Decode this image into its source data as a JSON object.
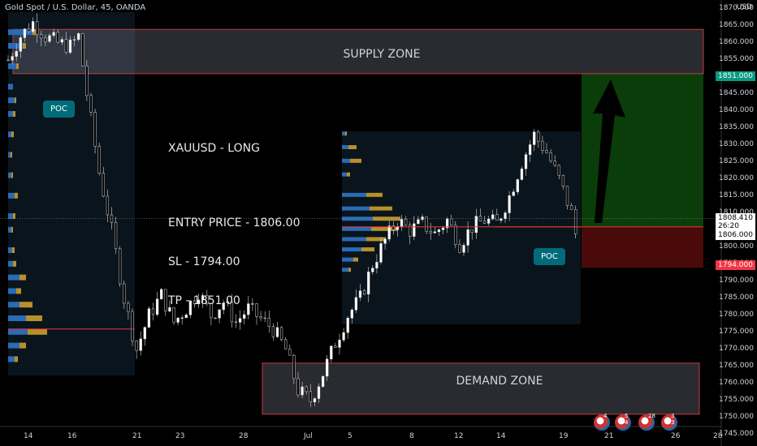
{
  "header": {
    "symbol_line": "Gold Spot / U.S. Dollar, 45, OANDA",
    "currency": "USD"
  },
  "chart_data": {
    "type": "candlestick",
    "y_axis": {
      "ylim": [
        1745,
        1870
      ],
      "tick_labels": [
        "1870.000",
        "1865.000",
        "1860.000",
        "1855.000",
        "1850.000",
        "1845.000",
        "1840.000",
        "1835.000",
        "1830.000",
        "1825.000",
        "1820.000",
        "1815.000",
        "1810.000",
        "1805.000",
        "1800.000",
        "1795.000",
        "1790.000",
        "1785.000",
        "1780.000",
        "1775.000",
        "1770.000",
        "1765.000",
        "1760.000",
        "1755.000",
        "1750.000",
        "1745.000"
      ]
    },
    "x_axis": {
      "tick_labels": [
        "14",
        "16",
        "21",
        "23",
        "28",
        "Jul",
        "5",
        "8",
        "12",
        "14",
        "19",
        "21",
        "26",
        "28"
      ]
    },
    "price_path": [
      [
        0,
        1855
      ],
      [
        3,
        1862
      ],
      [
        6,
        1866
      ],
      [
        9,
        1862
      ],
      [
        12,
        1860
      ],
      [
        15,
        1859
      ],
      [
        17,
        1862
      ],
      [
        19,
        1845
      ],
      [
        22,
        1822
      ],
      [
        25,
        1805
      ],
      [
        28,
        1785
      ],
      [
        31,
        1770
      ],
      [
        34,
        1780
      ],
      [
        37,
        1786
      ],
      [
        40,
        1778
      ],
      [
        43,
        1782
      ],
      [
        46,
        1787
      ],
      [
        49,
        1780
      ],
      [
        52,
        1784
      ],
      [
        55,
        1778
      ],
      [
        58,
        1782
      ],
      [
        61,
        1779
      ],
      [
        64,
        1776
      ],
      [
        67,
        1770
      ],
      [
        70,
        1758
      ],
      [
        73,
        1755
      ],
      [
        76,
        1763
      ],
      [
        79,
        1772
      ],
      [
        82,
        1780
      ],
      [
        85,
        1785
      ],
      [
        88,
        1795
      ],
      [
        91,
        1802
      ],
      [
        94,
        1808
      ],
      [
        97,
        1805
      ],
      [
        100,
        1807
      ],
      [
        103,
        1804
      ],
      [
        106,
        1808
      ],
      [
        109,
        1801
      ],
      [
        112,
        1806
      ],
      [
        115,
        1808
      ],
      [
        118,
        1807
      ],
      [
        121,
        1815
      ],
      [
        124,
        1825
      ],
      [
        127,
        1833
      ],
      [
        130,
        1828
      ],
      [
        133,
        1820
      ],
      [
        136,
        1810
      ],
      [
        137,
        1804
      ],
      [
        138,
        1808
      ]
    ],
    "supply_zone": {
      "label": "SUPPLY ZONE",
      "low": 1851,
      "high": 1864
    },
    "demand_zone": {
      "label": "DEMAND ZONE",
      "low": 1751,
      "high": 1766
    },
    "trade": {
      "entry": 1806.0,
      "stop_loss": 1794.0,
      "take_profit": 1851.0,
      "direction": "long",
      "arrow_color": "#2962ff"
    },
    "current_price": "1808.410",
    "countdown": "26:20",
    "price_tags": {
      "tp": "1851.000",
      "current": "1808.410",
      "entry": "1806.000",
      "sl": "1794.000"
    },
    "volume_profiles": [
      {
        "poc_label": "POC",
        "poc_price": 1776
      },
      {
        "poc_label": "POC",
        "poc_price": 1806
      }
    ],
    "colors": {
      "profit_zone": "#0a3d0a",
      "loss_zone": "#4a0a0a",
      "tp_tag": "#089981",
      "sl_tag": "#f23645",
      "vp_up": "#2a6bb5",
      "vp_down": "#b8902a",
      "poc": "#006c7a"
    }
  },
  "annotation": {
    "lines": [
      "XAUUSD - LONG",
      "",
      "ENTRY PRICE - 1806.00",
      "SL - 1794.00",
      "TP - 1851.00"
    ]
  },
  "events": [
    {
      "count": "4"
    },
    {
      "count": "5 4"
    },
    {
      "count": "28"
    },
    {
      "count": "3 3"
    }
  ]
}
